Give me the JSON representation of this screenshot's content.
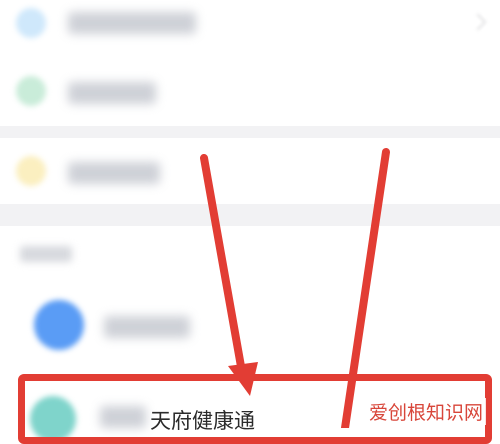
{
  "settings_list": {
    "items": [
      {
        "icon": "blue-app-icon",
        "color": "#cfe8fb"
      },
      {
        "icon": "green-app-icon",
        "color": "#c9ecd9"
      },
      {
        "icon": "yellow-app-icon",
        "color": "#fbefc0"
      }
    ]
  },
  "apps_section": {
    "app_item_1": {
      "icon": "blue-app-icon",
      "color": "#5a9cf5"
    },
    "app_item_2": {
      "icon": "teal-app-icon",
      "color": "#7fd4cb",
      "label": "天府健康通"
    }
  },
  "annotation": {
    "highlight_color": "#e23d34"
  },
  "watermark": {
    "text": "爱创根知识网"
  }
}
